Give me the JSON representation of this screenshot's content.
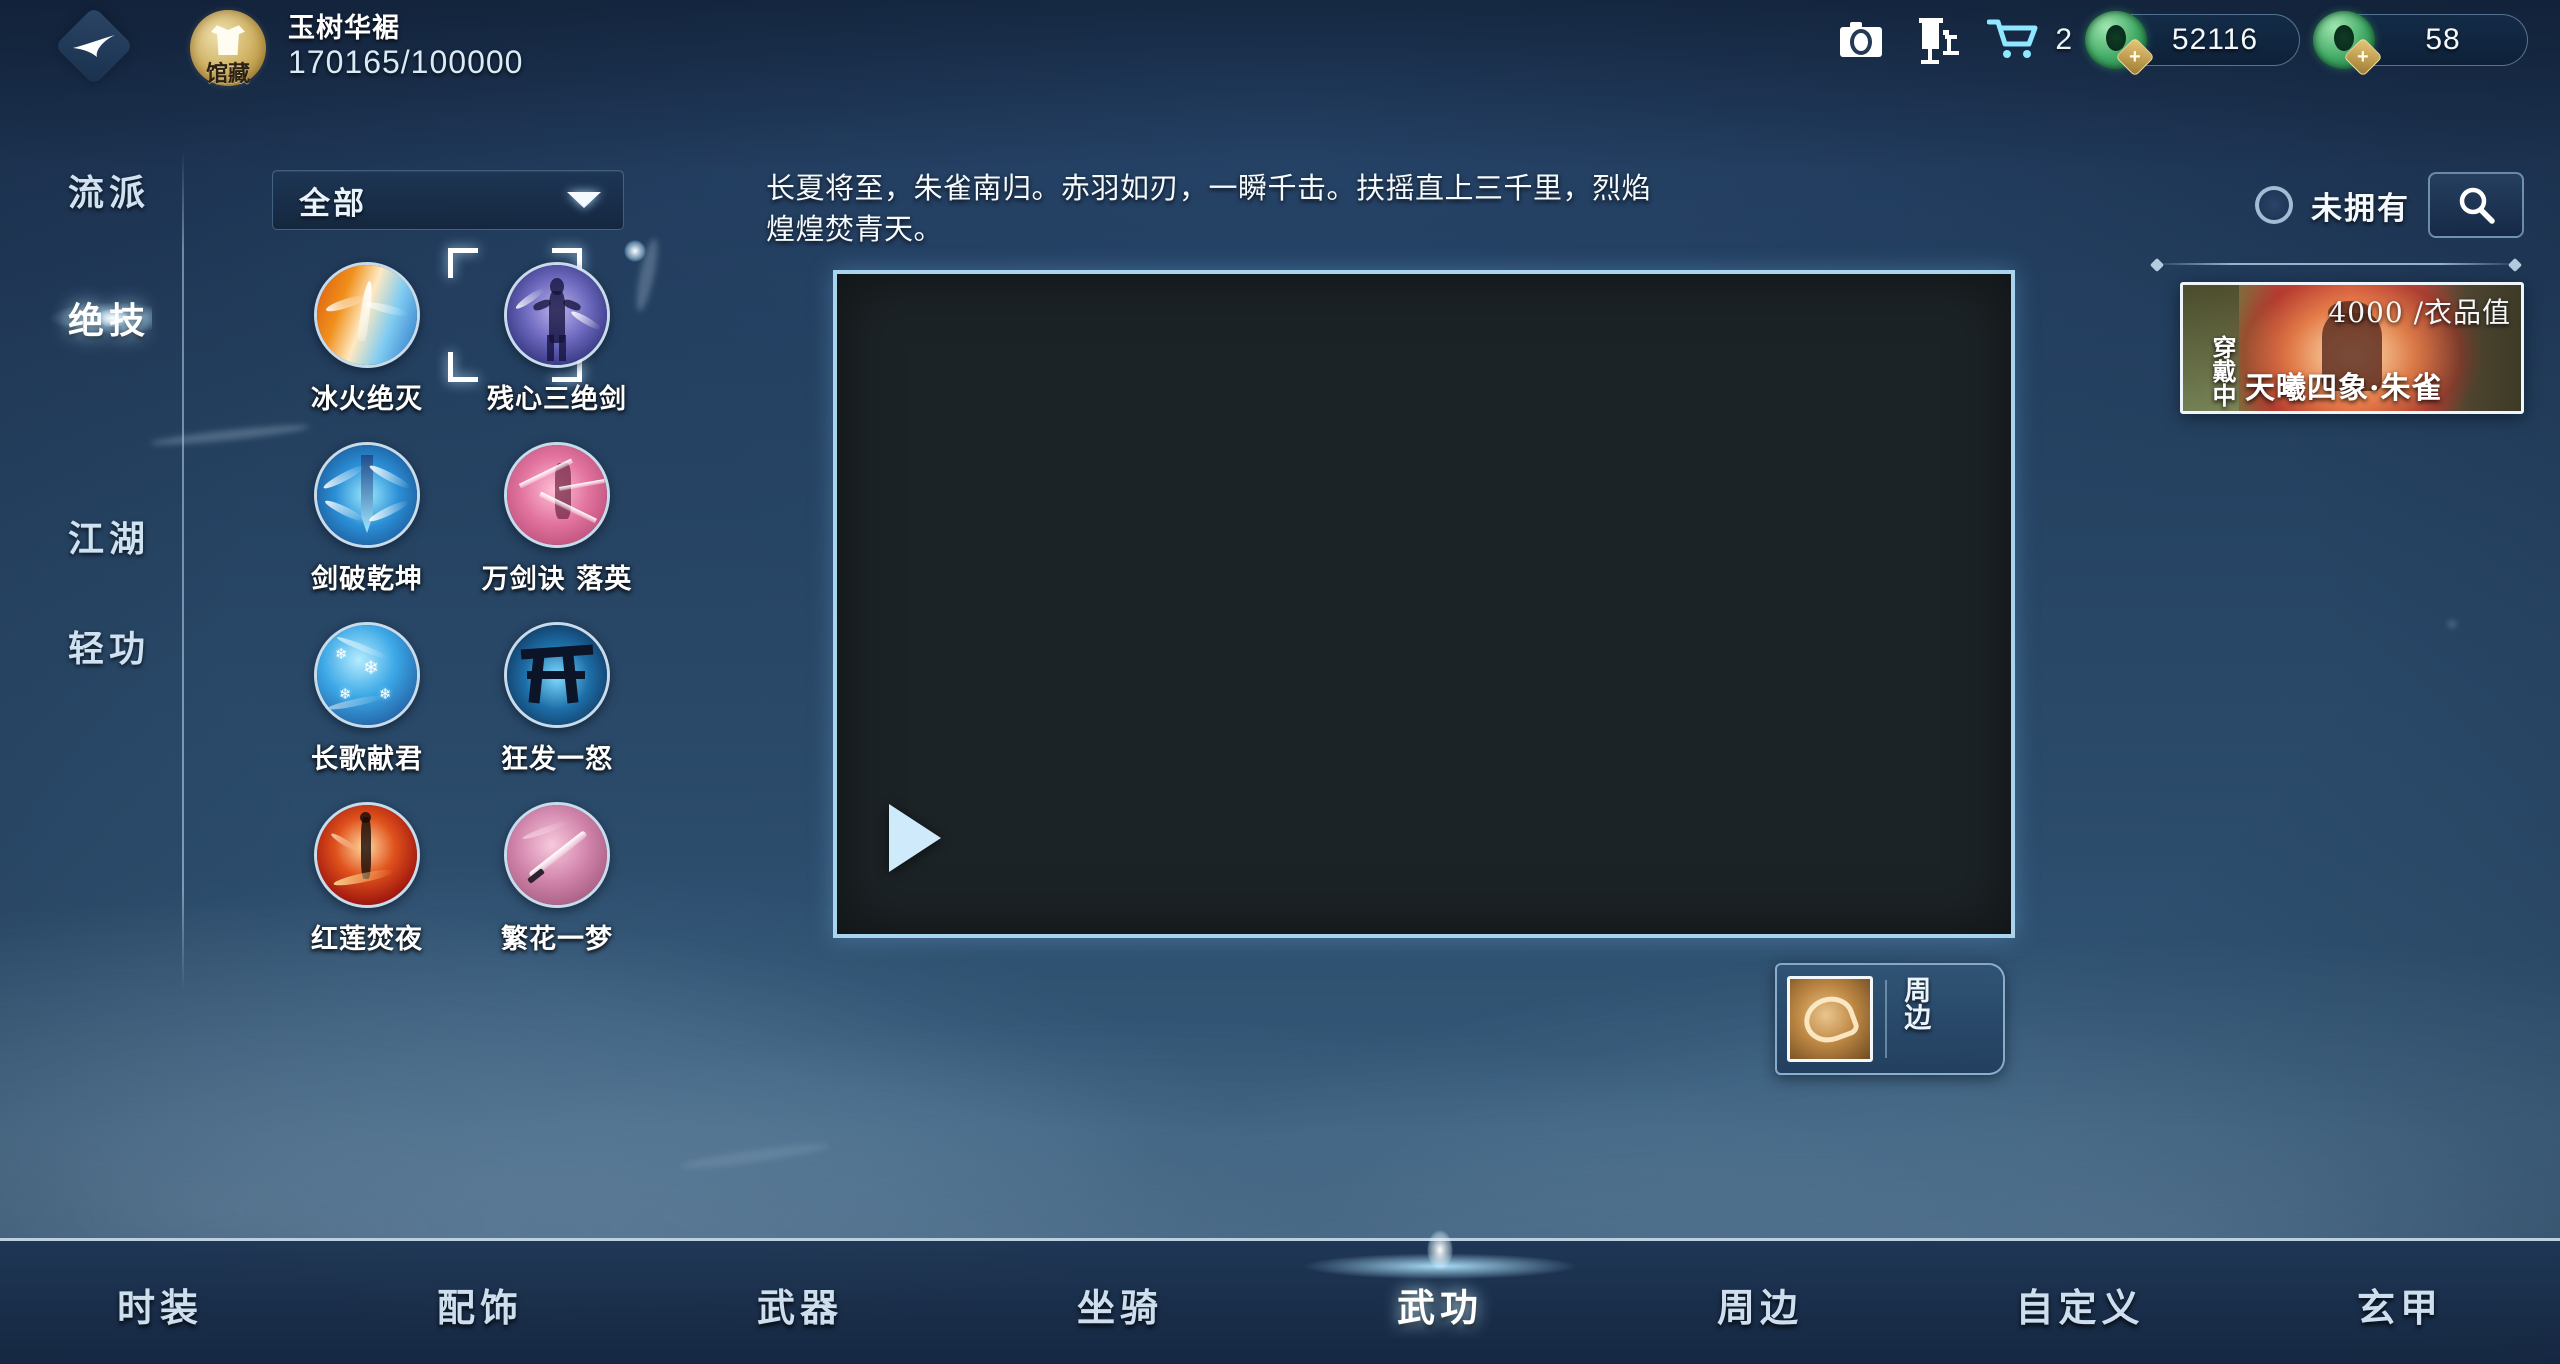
{
  "header": {
    "back_icon": "back-arrow-icon",
    "emblem_label": "馆藏",
    "player_name": "玉树华裾",
    "player_score": "170165/100000",
    "camera_icon": "camera-icon",
    "station_icon": "station-icon",
    "cart_icon": "shopping-cart-icon",
    "cart_count": "2",
    "currency_primary": "52116",
    "currency_secondary": "58"
  },
  "sidebar": {
    "items": [
      {
        "label": "流派",
        "active": false
      },
      {
        "label": "绝技",
        "active": true
      },
      {
        "label": "江湖",
        "active": false
      },
      {
        "label": "轻功",
        "active": false
      }
    ]
  },
  "filter": {
    "selected": "全部",
    "chevron_icon": "chevron-down-icon"
  },
  "skills": [
    {
      "name": "冰火绝灭",
      "art": "art-phoenix",
      "selected": false
    },
    {
      "name": "残心三绝剑",
      "art": "art-swordman",
      "selected": true
    },
    {
      "name": "剑破乾坤",
      "art": "art-bluesword",
      "selected": false
    },
    {
      "name": "万剑诀 落英",
      "art": "art-pinksword",
      "selected": false
    },
    {
      "name": "长歌献君",
      "art": "art-snow",
      "selected": false
    },
    {
      "name": "狂发一怒",
      "art": "art-kai",
      "selected": false
    },
    {
      "name": "红莲焚夜",
      "art": "art-redlotus",
      "selected": false
    },
    {
      "name": "繁花一梦",
      "art": "art-pinkblade",
      "selected": false
    }
  ],
  "detail": {
    "description": "长夏将至，朱雀南归。赤羽如刃，一瞬千击。扶摇直上三千里，烈焰煌煌焚青天。",
    "play_icon": "play-icon"
  },
  "side_badge": {
    "label": "周边",
    "thumb_icon": "phoenix-artwork-icon"
  },
  "right_panel": {
    "owned_filter_label": "未拥有",
    "search_icon": "search-icon",
    "card": {
      "price": "4000",
      "price_unit": "/衣品值",
      "status": "穿戴中",
      "title": "天曦四象·朱雀"
    }
  },
  "bottom_nav": {
    "items": [
      {
        "label": "时装",
        "active": false
      },
      {
        "label": "配饰",
        "active": false
      },
      {
        "label": "武器",
        "active": false
      },
      {
        "label": "坐骑",
        "active": false
      },
      {
        "label": "武功",
        "active": true
      },
      {
        "label": "周边",
        "active": false
      },
      {
        "label": "自定义",
        "active": false
      },
      {
        "label": "玄甲",
        "active": false
      }
    ]
  },
  "colors": {
    "accent": "#a9d4ef",
    "bg_deep": "#1d3354",
    "bg_mid": "#2c4c6c",
    "gold": "#c9a957",
    "jade": "#3fa863"
  }
}
